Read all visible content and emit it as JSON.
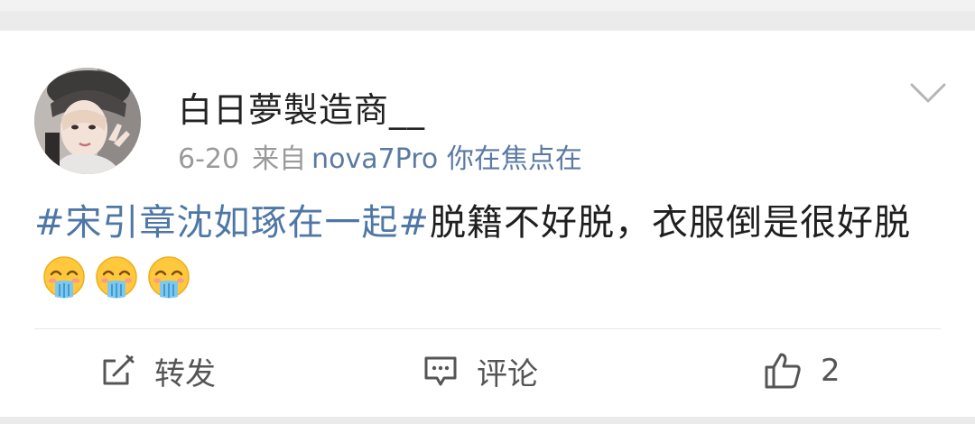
{
  "post": {
    "username": "白日夢製造商__",
    "date": "6-20",
    "source_label": "来自",
    "source": "nova7Pro 你在焦点在",
    "hashtag": "#宋引章沈如琢在一起#",
    "text": "脱籍不好脱，衣服倒是很好脱",
    "emojis": [
      "drooling-face-emoji",
      "drooling-face-emoji",
      "drooling-face-emoji"
    ]
  },
  "actions": {
    "repost_label": "转发",
    "comment_label": "评论",
    "like_count": "2"
  },
  "icons": {
    "menu": "chevron-down-icon",
    "repost": "repost-icon",
    "comment": "comment-icon",
    "like": "thumbs-up-icon"
  },
  "colors": {
    "hashtag": "#4f77a6",
    "source_link": "#5b7aa3",
    "meta_text": "#9a9a9a",
    "icon_gray": "#555555"
  }
}
